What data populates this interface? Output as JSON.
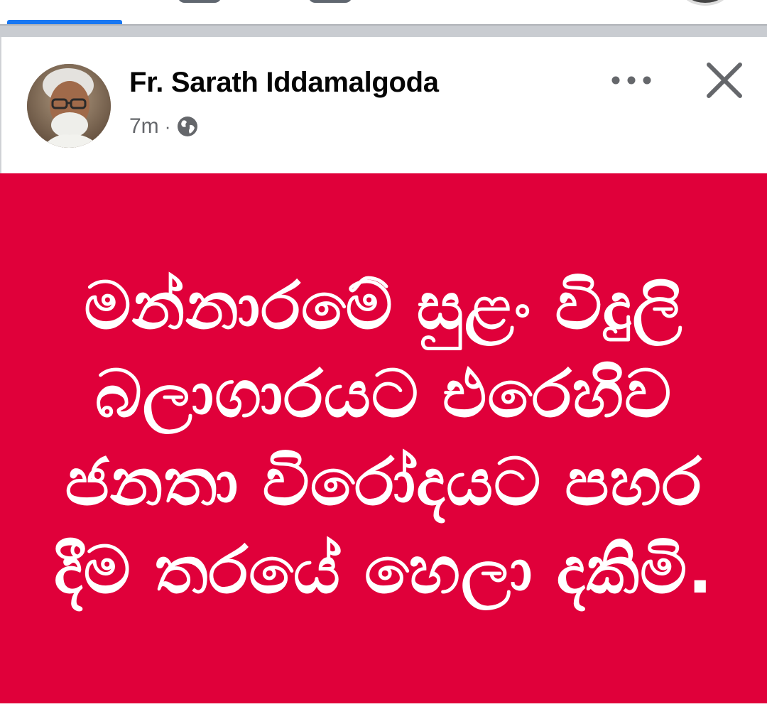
{
  "post": {
    "author_name": "Fr. Sarath Iddamalgoda",
    "time_ago": "7m",
    "separator": "·",
    "audience_icon": "globe-icon",
    "more_icon": "more-horizontal-icon",
    "close_icon": "close-icon",
    "banner_text": "මන්නාරමේ සුළං විදුලි බලාගාරයට එරෙහිව ජනතා විරෝදයට පහර දීම තරයේ හෙලා දකිමි.",
    "banner_color": "#e0003a"
  },
  "colors": {
    "accent": "#1877f2",
    "text_primary": "#050505",
    "text_secondary": "#65676b"
  }
}
